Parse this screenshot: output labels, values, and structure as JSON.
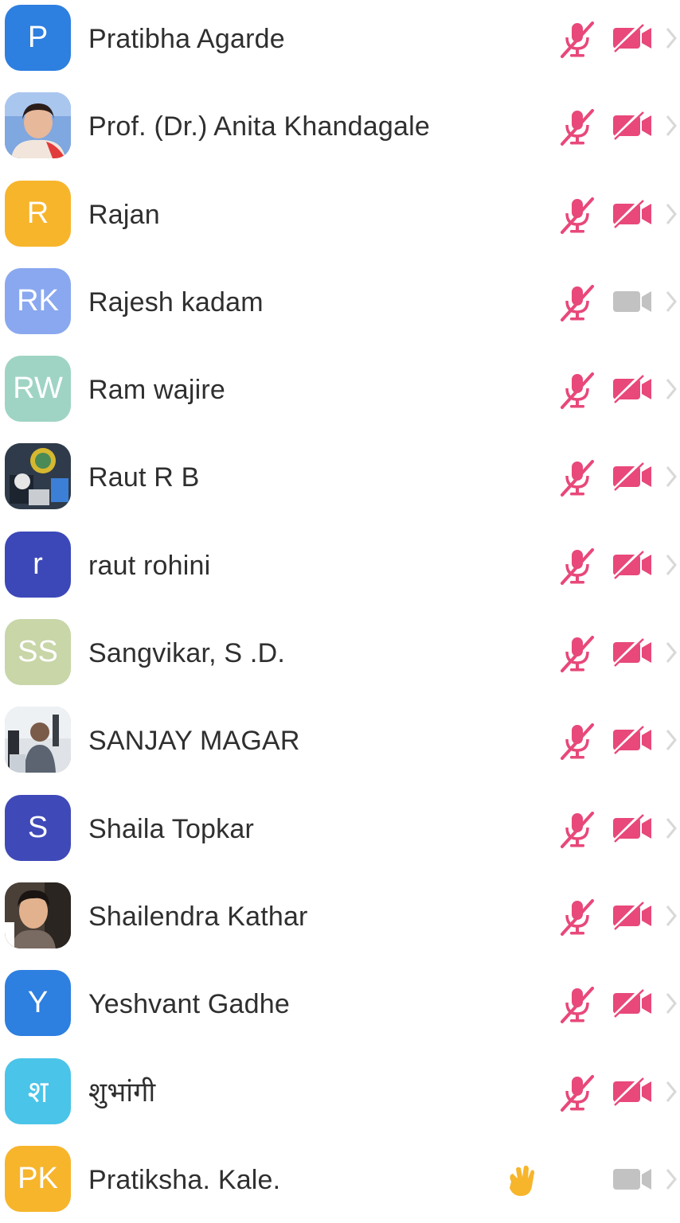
{
  "accent_red": "#e8487a",
  "muted_gray": "#c2c2c2",
  "participants": [
    {
      "name": "Pratibha Agarde",
      "initials": "P",
      "avatar_color": "#2d7fe0",
      "avatar_type": "initials",
      "audio": "muted",
      "video": "off",
      "raised_hand": false
    },
    {
      "name": "Prof. (Dr.) Anita Khandagale",
      "initials": "",
      "avatar_color": "#5a7bd0",
      "avatar_type": "photo",
      "audio": "muted",
      "video": "off",
      "raised_hand": false
    },
    {
      "name": "Rajan",
      "initials": "R",
      "avatar_color": "#f7b52c",
      "avatar_type": "initials",
      "audio": "muted",
      "video": "off",
      "raised_hand": false
    },
    {
      "name": "Rajesh kadam",
      "initials": "RK",
      "avatar_color": "#8aa8ef",
      "avatar_type": "initials",
      "audio": "muted",
      "video": "unavailable",
      "raised_hand": false
    },
    {
      "name": "Ram wajire",
      "initials": "RW",
      "avatar_color": "#9fd4c4",
      "avatar_type": "initials",
      "audio": "muted",
      "video": "off",
      "raised_hand": false
    },
    {
      "name": "Raut R B",
      "initials": "",
      "avatar_color": "#3f5a7a",
      "avatar_type": "photo",
      "audio": "muted",
      "video": "off",
      "raised_hand": false
    },
    {
      "name": "raut rohini",
      "initials": "r",
      "avatar_color": "#3c48b8",
      "avatar_type": "initials",
      "audio": "muted",
      "video": "off",
      "raised_hand": false
    },
    {
      "name": "Sangvikar, S .D.",
      "initials": "SS",
      "avatar_color": "#c8d6a8",
      "avatar_type": "initials",
      "audio": "muted",
      "video": "off",
      "raised_hand": false
    },
    {
      "name": "SANJAY MAGAR",
      "initials": "",
      "avatar_color": "#8a8f96",
      "avatar_type": "photo",
      "audio": "muted",
      "video": "off",
      "raised_hand": false
    },
    {
      "name": "Shaila Topkar",
      "initials": "S",
      "avatar_color": "#3f49b8",
      "avatar_type": "initials",
      "audio": "muted",
      "video": "off",
      "raised_hand": false
    },
    {
      "name": "Shailendra Kathar",
      "initials": "",
      "avatar_color": "#6a5a50",
      "avatar_type": "photo",
      "audio": "muted",
      "video": "off",
      "raised_hand": false
    },
    {
      "name": "Yeshvant Gadhe",
      "initials": "Y",
      "avatar_color": "#2d7fe0",
      "avatar_type": "initials",
      "audio": "muted",
      "video": "off",
      "raised_hand": false
    },
    {
      "name": "शुभांगी",
      "initials": "श",
      "avatar_color": "#4ac4e8",
      "avatar_type": "initials",
      "audio": "muted",
      "video": "off",
      "raised_hand": false
    },
    {
      "name": "Pratiksha. Kale.",
      "initials": "PK",
      "avatar_color": "#f7b52c",
      "avatar_type": "initials",
      "audio": "none",
      "video": "unavailable",
      "raised_hand": true
    }
  ]
}
